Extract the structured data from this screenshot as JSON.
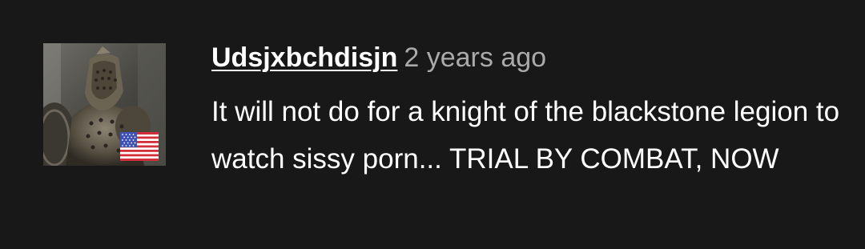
{
  "comment": {
    "author": "Udsjxbchdisjn",
    "timestamp": "2 years ago",
    "text": "It will not do for a knight of the blackstone legion to watch sissy porn... TRIAL BY COMBAT, NOW",
    "avatar_icon": "knight-avatar",
    "badge_icon": "us-flag-icon"
  },
  "colors": {
    "background": "#181818",
    "text": "#ffffff",
    "muted": "#aaaaaa"
  }
}
